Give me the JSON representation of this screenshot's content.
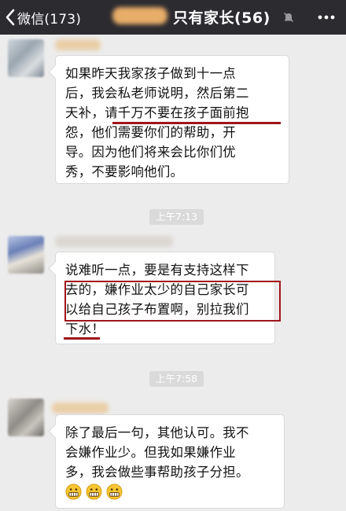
{
  "header": {
    "back_label": "微信(173)",
    "title": "只有家长(56)",
    "bg_color": "#2b2b30"
  },
  "messages": [
    {
      "lines": [
        "如果昨天我家孩子做到十一点",
        "后，我会私老师说明，然后第二",
        "天补，请千万不要在孩子面前抱",
        "怨，他们需要你们的帮助，开",
        "导。因为他们将来会比你们优",
        "秀，不要影响他们。"
      ]
    },
    {
      "timestamp": "上午7:13",
      "lines": [
        "说难听一点，要是有支持这样下",
        "去的，嫌作业太少的自己家长可",
        "以给自己孩子布置啊，别拉我们",
        "下水！"
      ]
    },
    {
      "timestamp": "上午7:58",
      "lines": [
        "除了最后一句，其他认可。我不",
        "会嫌作业少。但我如果嫌作业",
        "多，我会做些事帮助孩子分担。"
      ],
      "emojis": [
        "grimace-emoji",
        "grimace-emoji",
        "grimace-emoji"
      ]
    }
  ],
  "annotation_color": "#a0151b",
  "icons": {
    "back": "chevron-left-icon",
    "mute": "mute-bell-icon",
    "more": "more-dots-icon"
  }
}
